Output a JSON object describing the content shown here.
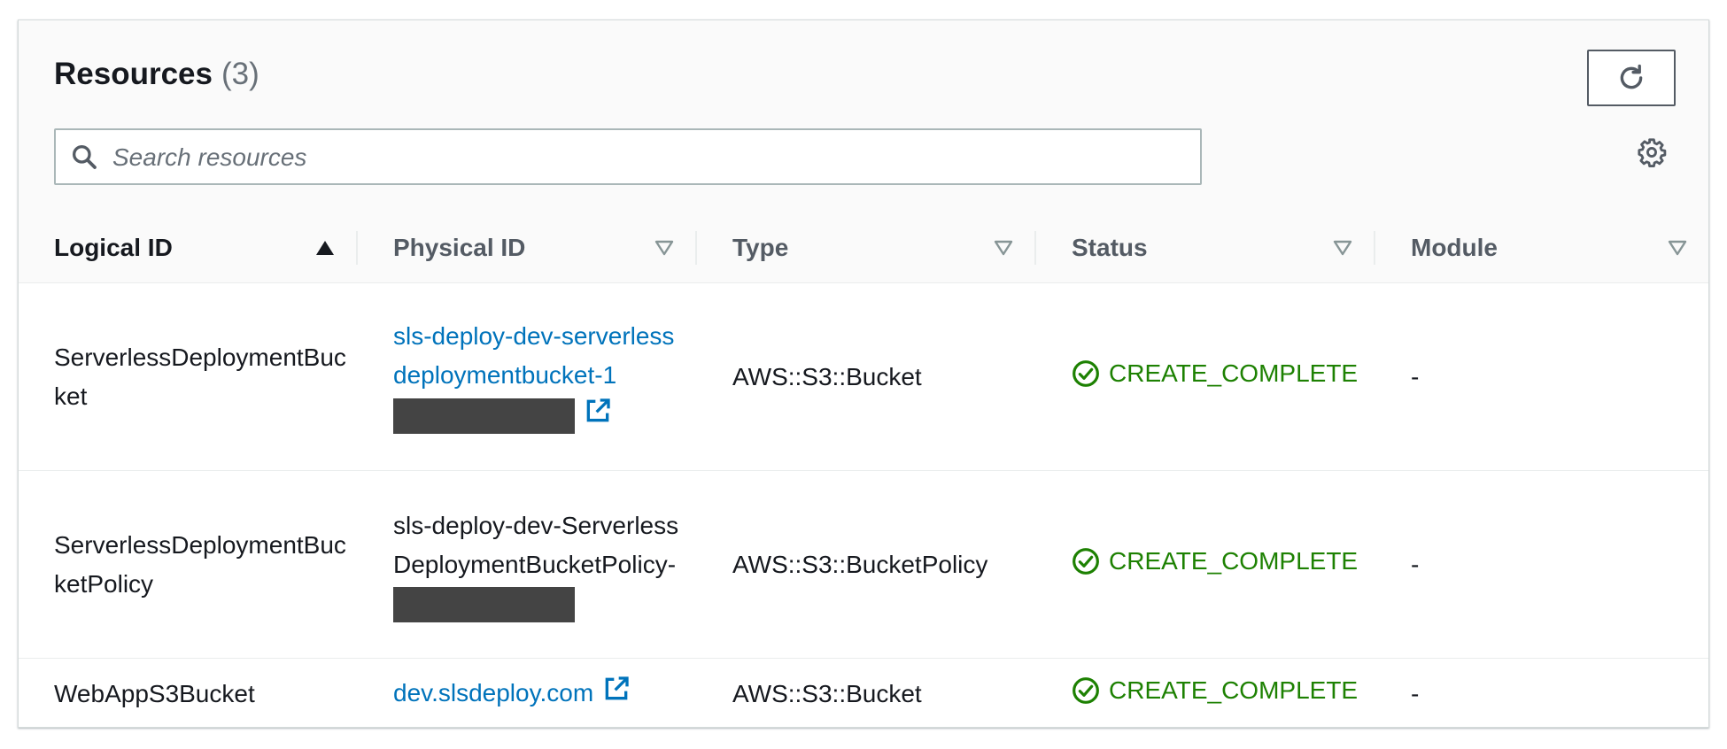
{
  "header": {
    "title": "Resources",
    "count": "(3)",
    "search_placeholder": "Search resources"
  },
  "icons": {
    "refresh": "refresh-icon",
    "search": "search-icon",
    "settings": "gear-icon",
    "sort_asc": "sort-ascending-icon",
    "sort_none": "sort-caret-icon",
    "external": "external-link-icon",
    "status": "check-circle-icon"
  },
  "colors": {
    "link": "#0073bb",
    "success": "#1d8102",
    "header_bg": "#fafafa"
  },
  "table": {
    "columns": [
      {
        "label": "Logical ID",
        "sort": "ascending"
      },
      {
        "label": "Physical ID",
        "sort": "none"
      },
      {
        "label": "Type",
        "sort": "none"
      },
      {
        "label": "Status",
        "sort": "none"
      },
      {
        "label": "Module",
        "sort": "none"
      }
    ],
    "rows": [
      {
        "logical_id": "ServerlessDeploymentBucket",
        "physical_id": "sls-deploy-dev-serverlessdeploymentbucket-1",
        "type": "AWS::S3::Bucket",
        "status": "CREATE_COMPLETE",
        "module": "-"
      },
      {
        "logical_id": "ServerlessDeploymentBucketPolicy",
        "physical_id": "sls-deploy-dev-ServerlessDeploymentBucketPolicy-",
        "type": "AWS::S3::BucketPolicy",
        "status": "CREATE_COMPLETE",
        "module": "-"
      },
      {
        "logical_id": "WebAppS3Bucket",
        "physical_id": "dev.slsdeploy.com",
        "type": "AWS::S3::Bucket",
        "status": "CREATE_COMPLETE",
        "module": "-"
      }
    ]
  }
}
